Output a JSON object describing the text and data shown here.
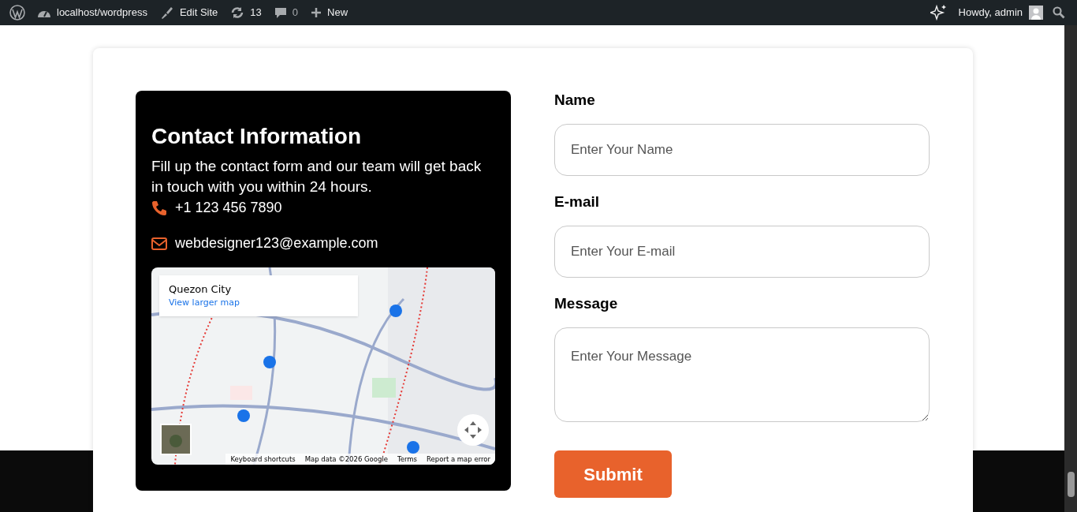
{
  "admin_bar": {
    "left": [
      {
        "kind": "wp"
      },
      {
        "kind": "site",
        "label": "localhost/wordpress"
      },
      {
        "kind": "edit",
        "label": "Edit Site"
      },
      {
        "kind": "updates",
        "label": "13"
      },
      {
        "kind": "comments",
        "label": "0"
      },
      {
        "kind": "new",
        "label": "New"
      }
    ],
    "greeting": "Howdy, admin"
  },
  "contact": {
    "title": "Contact Information",
    "text": "Fill up the contact form and our team will get back in touch with you within 24 hours.",
    "items": [
      {
        "kind": "phone",
        "label": "+1 123 456 7890"
      },
      {
        "kind": "email",
        "label": "webdesigner123@example.com"
      }
    ]
  },
  "map": {
    "place": "Quezon City",
    "link": "View larger map",
    "footer": [
      "Keyboard shortcuts",
      "Map data ©2026 Google",
      "Terms",
      "Report a map error"
    ]
  },
  "form": {
    "fields": [
      {
        "label": "Name",
        "placeholder": "Enter Your Name",
        "kind": "input"
      },
      {
        "label": "E-mail",
        "placeholder": "Enter Your E-mail",
        "kind": "input"
      },
      {
        "label": "Message",
        "placeholder": "Enter Your Message",
        "kind": "textarea"
      }
    ],
    "submit": "Submit"
  }
}
